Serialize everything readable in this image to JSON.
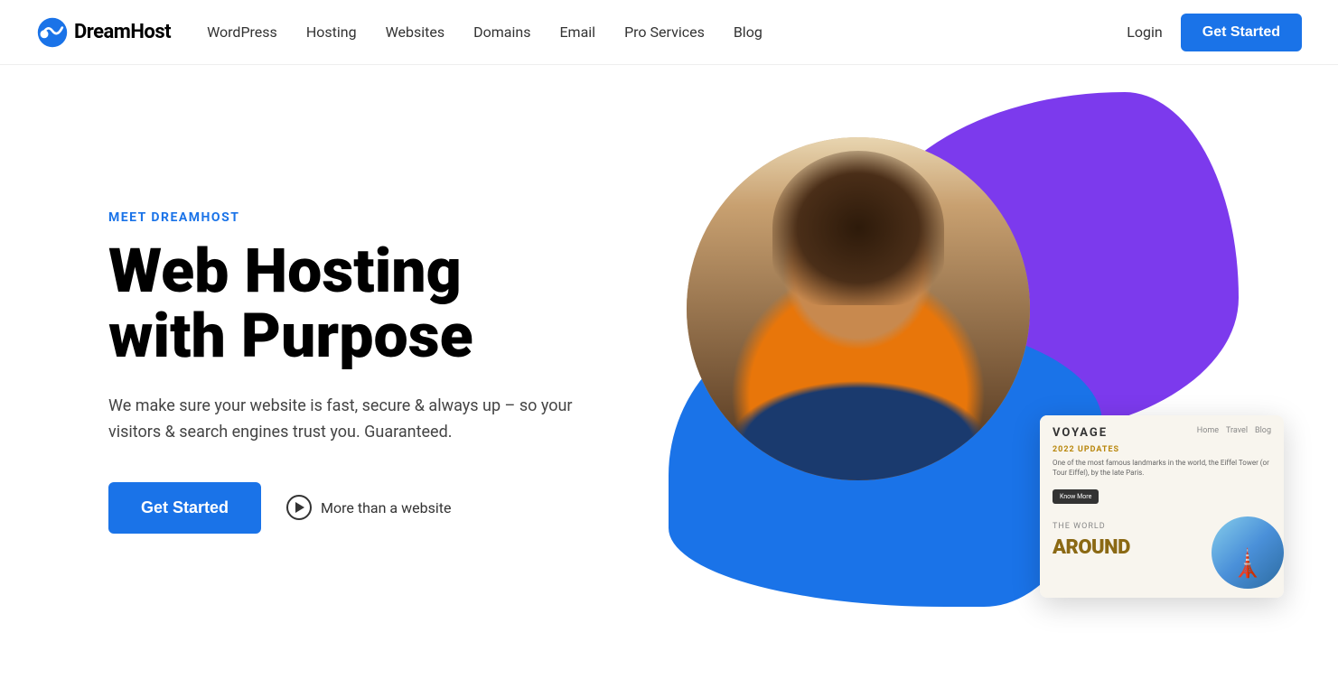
{
  "logo": {
    "text": "DreamHost",
    "alt": "DreamHost logo"
  },
  "nav": {
    "links": [
      {
        "id": "wordpress",
        "label": "WordPress"
      },
      {
        "id": "hosting",
        "label": "Hosting"
      },
      {
        "id": "websites",
        "label": "Websites"
      },
      {
        "id": "domains",
        "label": "Domains"
      },
      {
        "id": "email",
        "label": "Email"
      },
      {
        "id": "pro-services",
        "label": "Pro Services"
      },
      {
        "id": "blog",
        "label": "Blog"
      }
    ],
    "login_label": "Login",
    "cta_label": "Get Started"
  },
  "hero": {
    "eyebrow": "MEET DREAMHOST",
    "title_line1": "Web Hosting",
    "title_line2": "with Purpose",
    "description": "We make sure your website is fast, secure & always up – so your visitors & search engines trust you. Guaranteed.",
    "cta_label": "Get Started",
    "more_label": "More than a website"
  },
  "card": {
    "title": "VOYAGE",
    "nav_items": [
      "Home",
      "Travel",
      "Blog"
    ],
    "eyebrow": "2022 UPDATES",
    "body": "One of the most famous landmarks in the world, the Eiffel Tower (or Tour Eiffel), by the late Paris.",
    "know_more": "Know More",
    "big_text_line1": "THE WORLD",
    "big_text_line2": "AROUND"
  },
  "colors": {
    "blue": "#1a73e8",
    "purple": "#7c3aed",
    "dark": "#000000",
    "text": "#444444"
  }
}
